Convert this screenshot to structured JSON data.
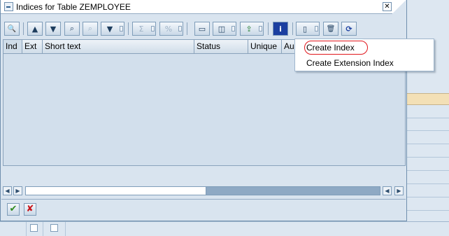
{
  "dialog": {
    "title": "Indices for Table ZEMPLOYEE",
    "close_glyph": "✕"
  },
  "toolbar": {
    "buttons": [
      {
        "icon": "details-icon",
        "glyph": "🔍"
      },
      {
        "icon": "sort-ascending-icon",
        "glyph": "▲"
      },
      {
        "icon": "sort-descending-icon",
        "glyph": "▼"
      },
      {
        "icon": "find-icon",
        "glyph": "⌕"
      },
      {
        "icon": "find-next-icon",
        "glyph": "⌕"
      },
      {
        "icon": "filter-icon",
        "glyph": "▼"
      },
      {
        "icon": "total-icon",
        "glyph": "Σ"
      },
      {
        "icon": "subtotal-icon",
        "glyph": "%"
      },
      {
        "icon": "print-icon",
        "glyph": "▭"
      },
      {
        "icon": "change-layout-icon",
        "glyph": "◫"
      },
      {
        "icon": "export-icon",
        "glyph": "⇪"
      },
      {
        "icon": "info-icon",
        "glyph": "i"
      },
      {
        "icon": "create-icon",
        "glyph": "▯"
      },
      {
        "icon": "delete-icon",
        "glyph": "🗑"
      },
      {
        "icon": "refresh-icon",
        "glyph": "⟳"
      }
    ]
  },
  "table": {
    "columns": [
      "Ind",
      "Ext",
      "Short text",
      "Status",
      "Unique",
      "Au"
    ]
  },
  "scrollbar": {
    "left_first": "◀",
    "left_prev": "▶",
    "right_prev": "◀",
    "right_next": "▶"
  },
  "footer": {
    "ok_glyph": "✔",
    "cancel_glyph": "✘"
  },
  "context_menu": {
    "items": [
      "Create Index",
      "Create Extension Index"
    ]
  },
  "colors": {
    "accent_red": "#e0161c",
    "ok_green": "#2f8a1e",
    "cancel_red": "#c8161c",
    "info_blue": "#1b3fa0"
  }
}
